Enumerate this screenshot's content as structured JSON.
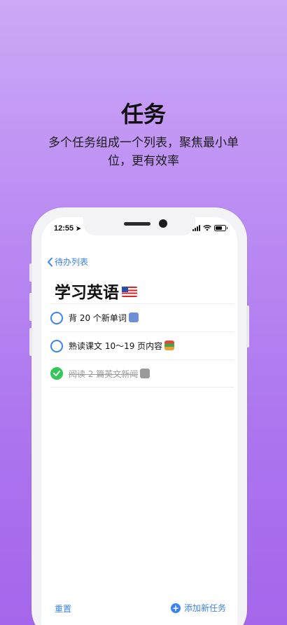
{
  "hero": {
    "title": "任务",
    "subtitle": "多个任务组成一个列表，聚焦最小单位，更有效率"
  },
  "status_bar": {
    "time": "12:55"
  },
  "nav": {
    "back_label": "待办列表"
  },
  "list": {
    "title": "学习英语",
    "tasks": [
      {
        "text": "背 20 个新单词",
        "done": false,
        "icon": "abc-letters-icon"
      },
      {
        "text": "熟读课文 10～19 页内容",
        "done": false,
        "icon": "books-icon"
      },
      {
        "text": "阅读 2 篇英文新闻",
        "done": true,
        "icon": "newspaper-icon"
      }
    ]
  },
  "footer": {
    "reset_label": "重置",
    "add_label": "添加新任务"
  },
  "colors": {
    "accent": "#3a82f7",
    "done": "#34c759",
    "background_top": "#cda8f6",
    "background_bottom": "#a566eb"
  }
}
